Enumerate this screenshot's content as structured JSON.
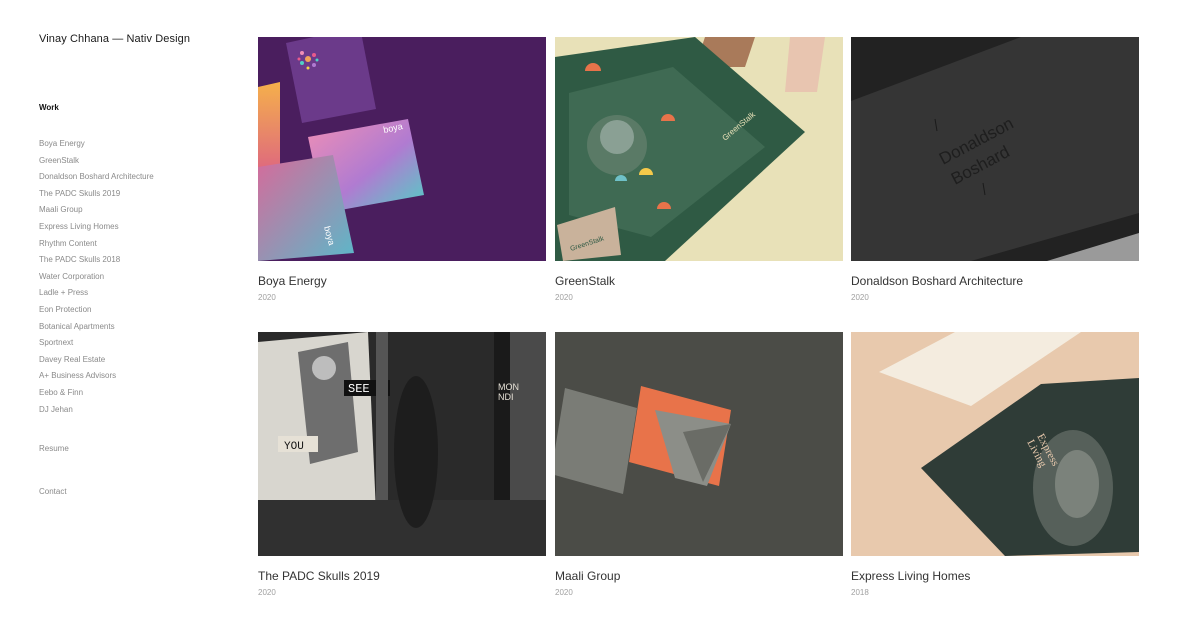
{
  "site": {
    "title": "Vinay Chhana — Nativ Design"
  },
  "nav": {
    "heading": "Work",
    "items": [
      "Boya Energy",
      "GreenStalk",
      "Donaldson Boshard Architecture",
      "The PADC Skulls 2019",
      "Maali Group",
      "Express Living Homes",
      "Rhythm Content",
      "The PADC Skulls 2018",
      "Water Corporation",
      "Ladle + Press",
      "Eon Protection",
      "Botanical Apartments",
      "Sportnext",
      "Davey Real Estate",
      "A+ Business Advisors",
      "Eebo & Finn",
      "DJ Jehan"
    ],
    "resume": "Resume",
    "contact": "Contact"
  },
  "projects": [
    {
      "title": "Boya Energy",
      "year": "2020",
      "thumb_text": [
        "boya",
        "boya"
      ]
    },
    {
      "title": "GreenStalk",
      "year": "2020",
      "thumb_text": [
        "GreenStalk",
        "GreenStalk"
      ]
    },
    {
      "title": "Donaldson Boshard Architecture",
      "year": "2020",
      "thumb_text": [
        "Donaldson",
        "Boshard"
      ]
    },
    {
      "title": "The PADC Skulls 2019",
      "year": "2020",
      "thumb_text": [
        "SEE",
        "YOU",
        "MON",
        "NDI"
      ]
    },
    {
      "title": "Maali Group",
      "year": "2020",
      "thumb_text": []
    },
    {
      "title": "Express Living Homes",
      "year": "2018",
      "thumb_text": [
        "Express",
        "Living"
      ]
    }
  ],
  "colors": {
    "boya_bg": "#4a1e5e",
    "greenstalk_bg": "#e8e1b8",
    "greenstalk_card": "#2f5a44",
    "donaldson_bg": "#2a2a2a",
    "padc_bg": "#3a3a3a",
    "maali_bg": "#4b4c47",
    "maali_accent": "#e8734a",
    "express_bg": "#e8c9ad",
    "express_card": "#2f3c37"
  }
}
